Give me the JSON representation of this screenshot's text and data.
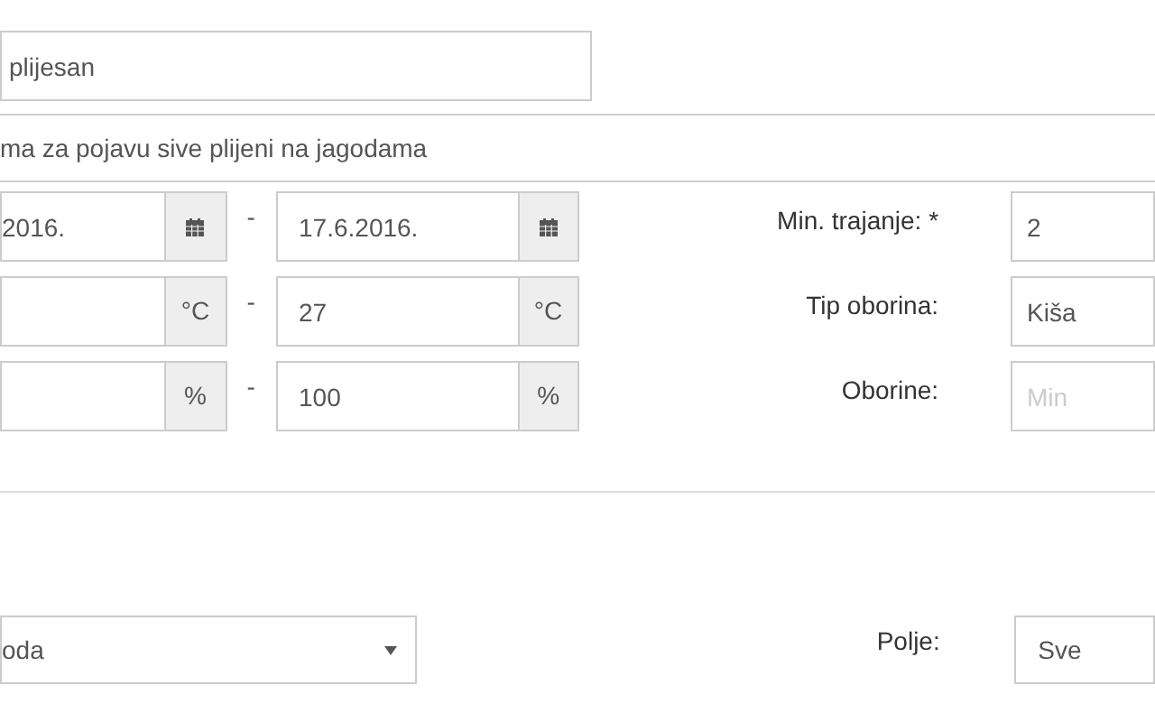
{
  "name_field": {
    "value": "plijesan"
  },
  "description_field": {
    "value": "ma za pojavu sive plijeni na jagodama"
  },
  "range_rows": [
    {
      "kind": "date",
      "from": "2016.",
      "separator": "-",
      "to": "17.6.2016.",
      "label": "Min. trajanje: *",
      "field": {
        "value": "2"
      }
    },
    {
      "kind": "unit",
      "unit_from": "°C",
      "separator": "-",
      "to": "27",
      "unit_to": "°C",
      "label": "Tip oborina:",
      "field": {
        "value": "Kiša"
      }
    },
    {
      "kind": "unit",
      "unit_from": "%",
      "separator": "-",
      "to": "100",
      "unit_to": "%",
      "label": "Oborine:",
      "field": {
        "placeholder": "Min"
      }
    }
  ],
  "bottom_row": {
    "select": {
      "value": "oda"
    },
    "label": "Polje:",
    "field": {
      "value": "Sve"
    }
  }
}
